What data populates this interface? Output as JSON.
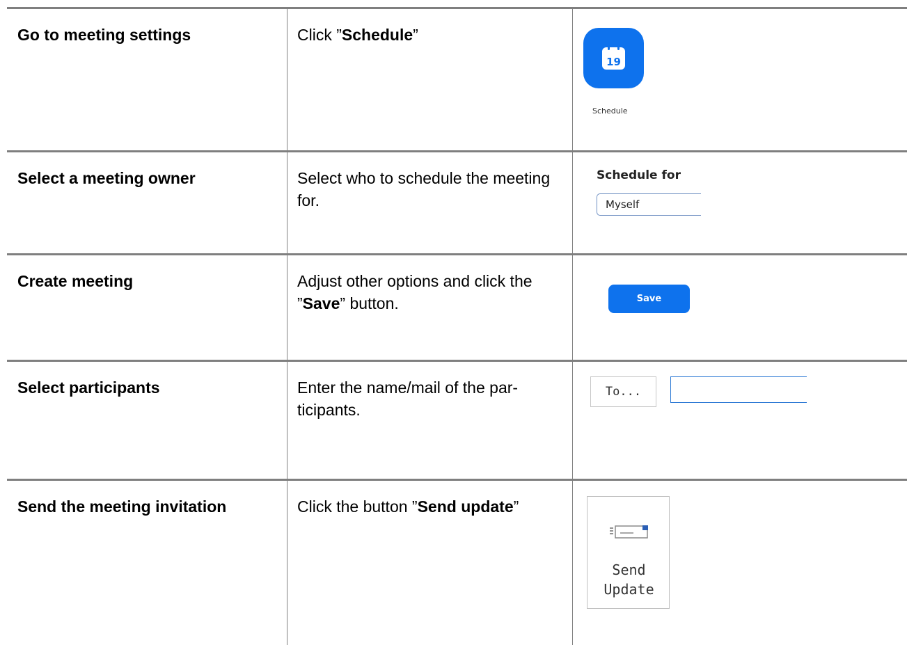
{
  "rows": [
    {
      "step": "Go to meeting settings",
      "desc_parts": [
        "Click ”",
        "Schedule",
        "”"
      ]
    },
    {
      "step": "Select a meeting owner",
      "desc_parts": [
        "Select who to schedule the meeting for."
      ]
    },
    {
      "step": "Create meeting",
      "desc_parts": [
        "Adjust other options and click the ”",
        "Save",
        "” button."
      ]
    },
    {
      "step": "Select participants",
      "desc_parts": [
        "Enter the name/mail of the par-ticipants."
      ]
    },
    {
      "step": "Send the meeting invitation",
      "desc_parts": [
        "Click the button ”",
        "Send update",
        "”"
      ]
    }
  ],
  "ui": {
    "schedule_icon_day": "19",
    "schedule_caption": "Schedule",
    "schedule_for_label": "Schedule for",
    "schedule_for_value": "Myself",
    "save_label": "Save",
    "to_label": "To...",
    "to_value": "",
    "send_update_line1": "Send",
    "send_update_line2": "Update"
  },
  "colors": {
    "zoom_blue": "#0e72ed",
    "grid_line": "#7f7f7f"
  },
  "icons": [
    "calendar-icon",
    "envelope-send-icon"
  ]
}
